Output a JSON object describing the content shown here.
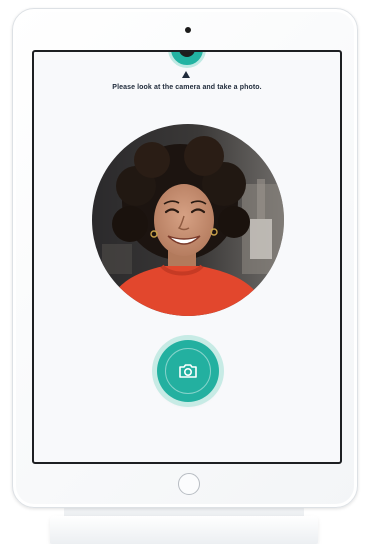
{
  "screen": {
    "instruction": "Please look at the camera and take a photo."
  },
  "capture": {
    "button_icon": "camera-icon"
  },
  "colors": {
    "accent": "#23b0a0",
    "accent_light": "#c7ebe5",
    "text": "#1f2a3a",
    "screen_bg": "#f8f9fb"
  }
}
